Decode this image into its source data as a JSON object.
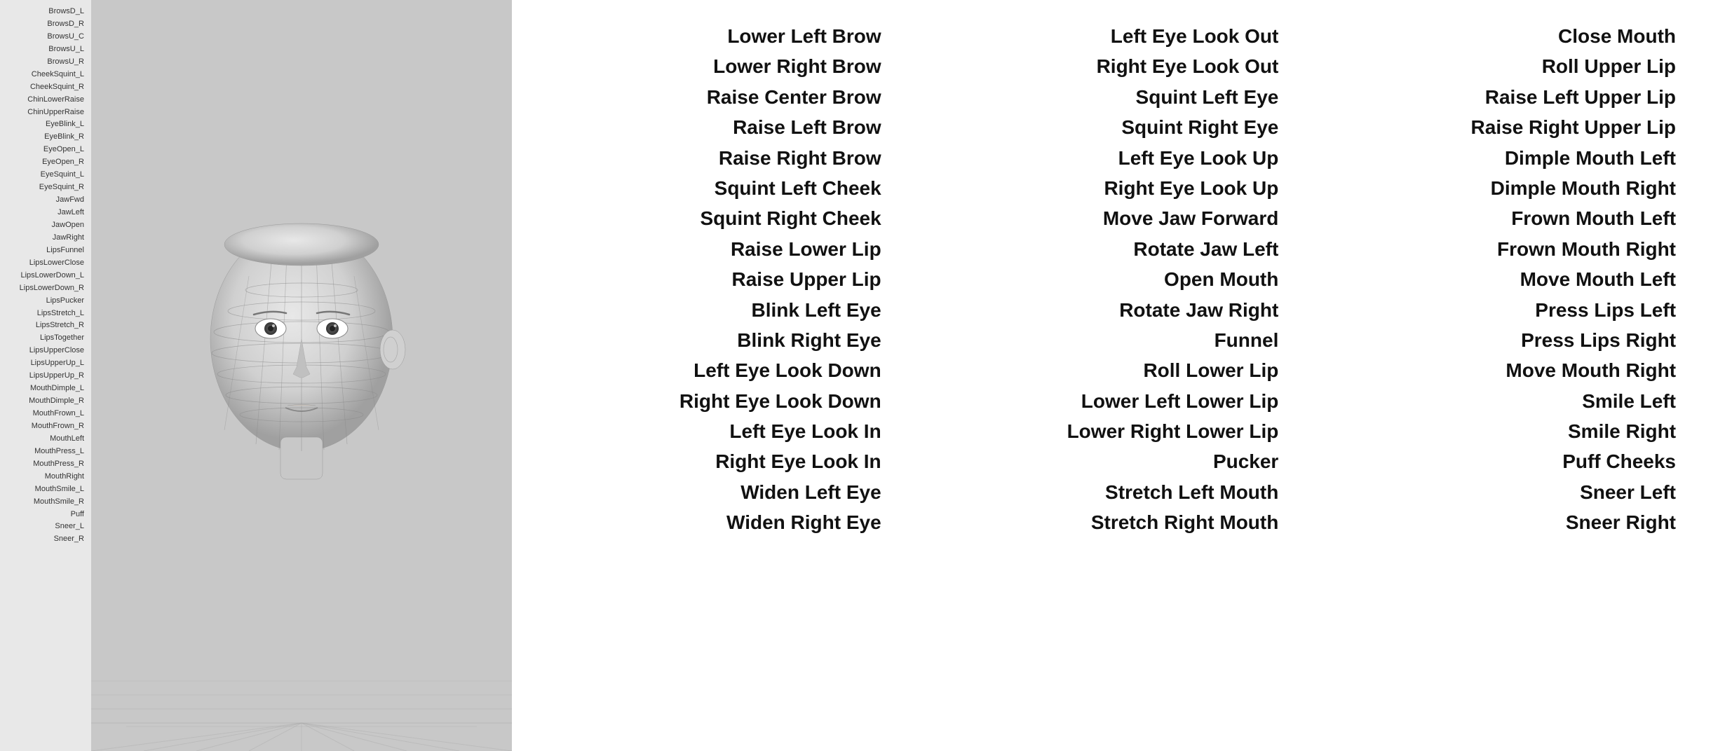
{
  "sidebar": {
    "items": [
      "BrowsD_L",
      "BrowsD_R",
      "BrowsU_C",
      "BrowsU_L",
      "BrowsU_R",
      "CheekSquint_L",
      "CheekSquint_R",
      "ChinLowerRaise",
      "ChinUpperRaise",
      "EyeBlink_L",
      "EyeBlink_R",
      "EyeOpen_L",
      "EyeOpen_R",
      "EyeSquint_L",
      "EyeSquint_R",
      "JawFwd",
      "JawLeft",
      "JawOpen",
      "JawRight",
      "LipsFunnel",
      "LipsLowerClose",
      "LipsLowerDown_L",
      "LipsLowerDown_R",
      "LipsPucker",
      "LipsStretch_L",
      "LipsStretch_R",
      "LipsTogether",
      "LipsUpperClose",
      "LipsUpperUp_L",
      "LipsUpperUp_R",
      "MouthDimple_L",
      "MouthDimple_R",
      "MouthFrown_L",
      "MouthFrown_R",
      "MouthLeft",
      "MouthPress_L",
      "MouthPress_R",
      "MouthRight",
      "MouthSmile_L",
      "MouthSmile_R",
      "Puff",
      "Sneer_L",
      "Sneer_R"
    ]
  },
  "columns": [
    {
      "id": "col1",
      "items": [
        "Lower Left Brow",
        "Lower Right Brow",
        "Raise Center Brow",
        "Raise Left Brow",
        "Raise Right Brow",
        "Squint Left Cheek",
        "Squint Right Cheek",
        "Raise Lower Lip",
        "Raise Upper Lip",
        "Blink Left Eye",
        "Blink Right Eye",
        "Left Eye Look Down",
        "Right Eye Look Down",
        "Left Eye Look In",
        "Right Eye Look In",
        "Widen Left Eye",
        "Widen Right Eye"
      ]
    },
    {
      "id": "col2",
      "items": [
        "Left Eye Look Out",
        "Right Eye Look Out",
        "Squint Left Eye",
        "Squint Right Eye",
        "Left Eye Look Up",
        "Right Eye Look Up",
        "Move Jaw Forward",
        "Rotate Jaw Left",
        "Open Mouth",
        "Rotate Jaw Right",
        "Funnel",
        "Roll Lower Lip",
        "Lower Left Lower Lip",
        "Lower Right Lower Lip",
        "Pucker",
        "Stretch Left Mouth",
        "Stretch Right Mouth"
      ]
    },
    {
      "id": "col3",
      "items": [
        "Close Mouth",
        "Roll Upper Lip",
        "Raise Left Upper Lip",
        "Raise Right Upper Lip",
        "Dimple Mouth Left",
        "Dimple Mouth Right",
        "Frown Mouth Left",
        "Frown Mouth Right",
        "Move Mouth Left",
        "Press Lips Left",
        "Press Lips Right",
        "Move Mouth Right",
        "Smile Left",
        "Smile Right",
        "Puff Cheeks",
        "Sneer Left",
        "Sneer Right"
      ]
    }
  ]
}
